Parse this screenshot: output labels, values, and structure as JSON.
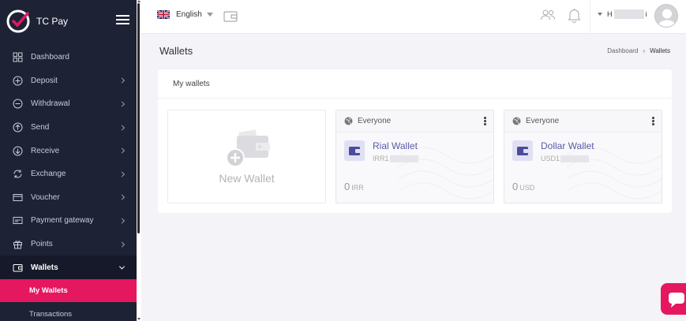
{
  "sidebar": {
    "brand": "TC Pay",
    "items": [
      {
        "label": "Dashboard",
        "icon": "dashboard-icon",
        "has_chevron": false
      },
      {
        "label": "Deposit",
        "icon": "plus-circle-icon",
        "has_chevron": true
      },
      {
        "label": "Withdrawal",
        "icon": "minus-circle-icon",
        "has_chevron": true
      },
      {
        "label": "Send",
        "icon": "arrow-up-circle-icon",
        "has_chevron": true
      },
      {
        "label": "Receive",
        "icon": "arrow-down-circle-icon",
        "has_chevron": true
      },
      {
        "label": "Exchange",
        "icon": "exchange-icon",
        "has_chevron": true
      },
      {
        "label": "Voucher",
        "icon": "voucher-icon",
        "has_chevron": true
      },
      {
        "label": "Payment gateway",
        "icon": "gateway-icon",
        "has_chevron": true
      },
      {
        "label": "Points",
        "icon": "gift-icon",
        "has_chevron": true
      },
      {
        "label": "Wallets",
        "icon": "wallet-icon",
        "has_chevron": true,
        "open": true
      }
    ],
    "subitems": [
      {
        "label": "My Wallets",
        "active": true
      },
      {
        "label": "Transactions",
        "active": false
      }
    ]
  },
  "topbar": {
    "language": "English",
    "user_initial": "H",
    "user_suffix": "i"
  },
  "page": {
    "title": "Wallets",
    "breadcrumb": [
      "Dashboard",
      "Wallets"
    ]
  },
  "card": {
    "title": "My wallets",
    "new_wallet_label": "New Wallet",
    "wallets": [
      {
        "visibility": "Everyone",
        "name": "Rial Wallet",
        "code_prefix": "IRR1",
        "balance": "0",
        "currency": "IRR"
      },
      {
        "visibility": "Everyone",
        "name": "Dollar Wallet",
        "code_prefix": "USD1",
        "balance": "0",
        "currency": "USD"
      }
    ]
  },
  "colors": {
    "sidebar_bg": "#1e2235",
    "accent": "#e5175f",
    "wallet_name": "#5a5aa8"
  }
}
